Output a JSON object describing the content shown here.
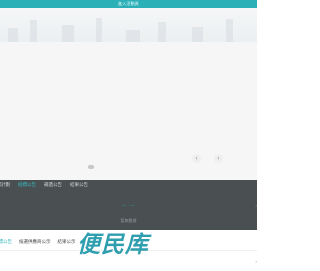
{
  "topbar": {
    "title": "進入活動頁"
  },
  "banner": {
    "prev_icon": "‹",
    "next_icon": "›"
  },
  "dark_tabs": [
    {
      "label": "招標計劃",
      "active": false
    },
    {
      "label": "招標公告",
      "active": true
    },
    {
      "label": "補遺公告",
      "active": false
    },
    {
      "label": "結果公告",
      "active": false
    }
  ],
  "dark_panel": {
    "link": "— · —",
    "empty_text": "暫無數據",
    "side": "›"
  },
  "sub_tabs": [
    {
      "label": "招標公告",
      "active": true
    },
    {
      "label": "候選供應商公示",
      "active": false
    },
    {
      "label": "結果公示",
      "active": false
    }
  ],
  "watermark": "便民库",
  "scroll_mark": "›"
}
